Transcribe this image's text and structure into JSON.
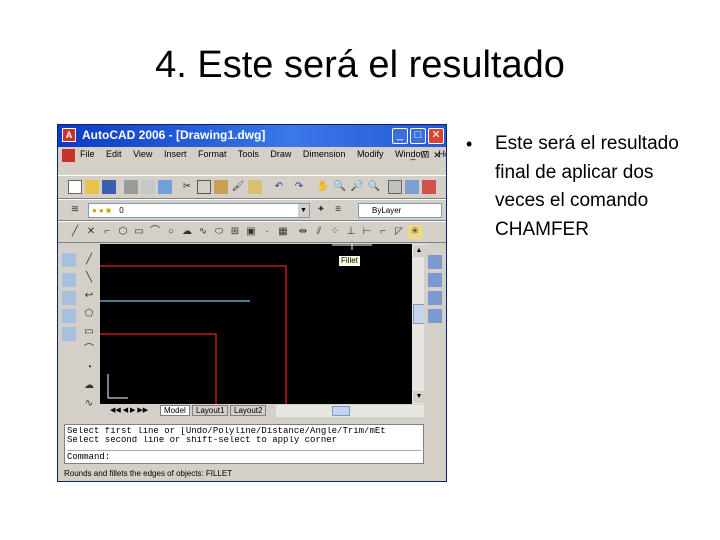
{
  "slide": {
    "title": "4. Este será el resultado",
    "bullet": "Este será el resultado final de aplicar dos veces el comando CHAMFER"
  },
  "app": {
    "window_title": "AutoCAD 2006 - [Drawing1.dwg]",
    "logo_letter": "A",
    "menus": [
      "File",
      "Edit",
      "View",
      "Insert",
      "Format",
      "Tools",
      "Draw",
      "Dimension",
      "Modify",
      "Window",
      "Help"
    ],
    "layer_value": "0",
    "linetype_value": "ByLayer",
    "tooltip": "Fillet",
    "tabs": [
      "Model",
      "Layout1",
      "Layout2"
    ],
    "command_lines": [
      "Select first line or [Undo/Polyline/Distance/Angle/Trim/mEt",
      "Select second line or shift-select to apply corner"
    ],
    "command_prompt": "Command:",
    "status_text": "Rounds and fillets the edges of objects:  FILLET"
  }
}
